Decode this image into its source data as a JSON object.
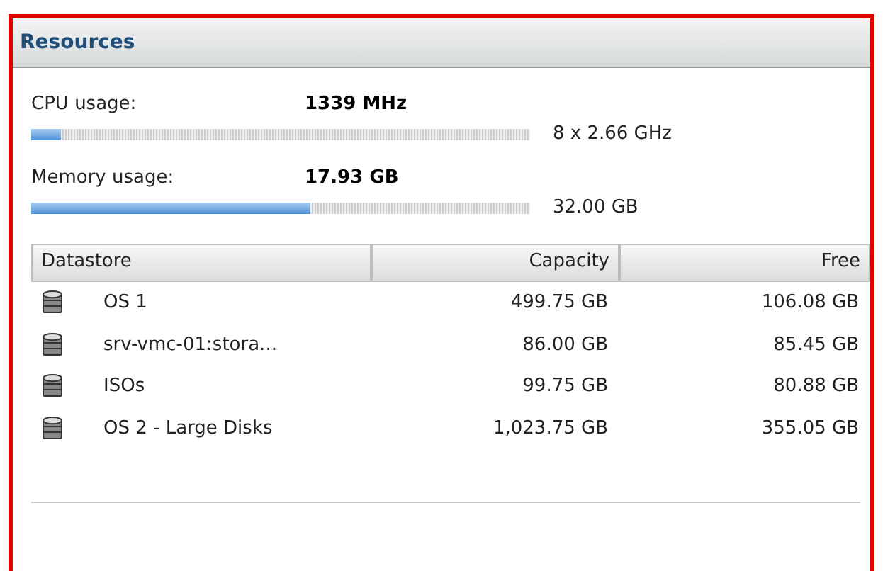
{
  "panel": {
    "title": "Resources"
  },
  "meters": [
    {
      "label": "CPU usage:",
      "value": "1339 MHz",
      "level": 0.06,
      "capacity": "8 x 2.66 GHz"
    },
    {
      "label": "Memory usage:",
      "value": "17.93 GB",
      "level": 0.56,
      "capacity": "32.00 GB"
    }
  ],
  "table": {
    "columns": [
      "Datastore",
      "Capacity",
      "Free"
    ],
    "rows": [
      {
        "name": "OS 1",
        "capacity": "499.75 GB",
        "free": "106.08 GB"
      },
      {
        "name": "srv-vmc-01:stora...",
        "capacity": "86.00 GB",
        "free": "85.45 GB"
      },
      {
        "name": "ISOs",
        "capacity": "99.75 GB",
        "free": "80.88 GB"
      },
      {
        "name": "OS 2 - Large Disks",
        "capacity": "1,023.75 GB",
        "free": "355.05 GB"
      }
    ]
  }
}
